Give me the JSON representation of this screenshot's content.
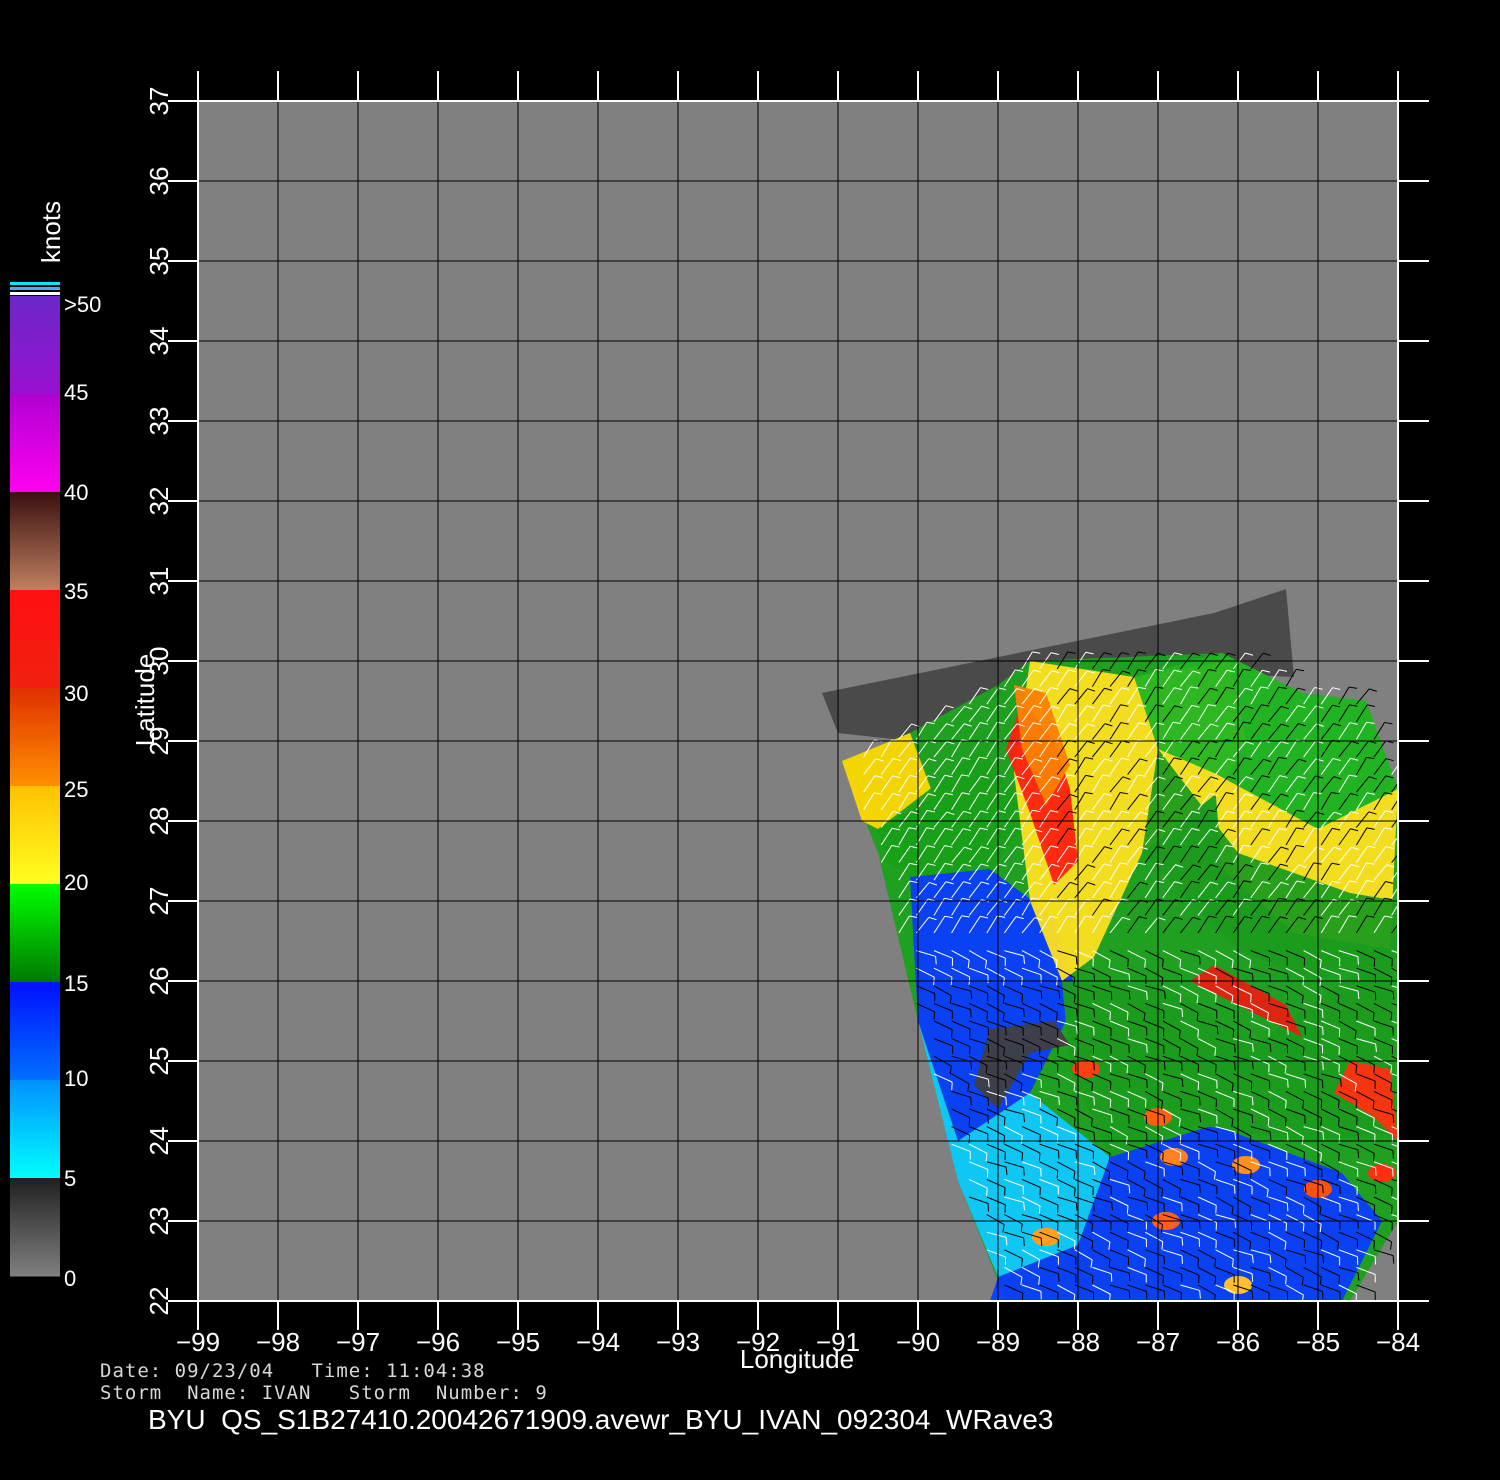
{
  "plot": {
    "xlabel": "Longitude",
    "ylabel": "Latitude",
    "lon_range": [
      -99,
      -84
    ],
    "lat_range": [
      22,
      37
    ],
    "lon_ticks": [
      -99,
      -98,
      -97,
      -96,
      -95,
      -94,
      -93,
      -92,
      -91,
      -90,
      -89,
      -88,
      -87,
      -86,
      -85,
      -84
    ],
    "lat_ticks": [
      22,
      23,
      24,
      25,
      26,
      27,
      28,
      29,
      30,
      31,
      32,
      33,
      34,
      35,
      36,
      37
    ],
    "background_color": "#808080",
    "grid": true
  },
  "colorbar": {
    "unit": "knots",
    "labels": [
      ">50",
      "45",
      "40",
      "35",
      "30",
      "25",
      "20",
      "15",
      "10",
      "5",
      "0"
    ],
    "bands": [
      {
        "from": 45,
        "to": 50,
        "top": "#6a28c8",
        "bottom": "#9a10d0"
      },
      {
        "from": 40,
        "to": 45,
        "top": "#b000d0",
        "bottom": "#ff00f0"
      },
      {
        "from": 35,
        "to": 40,
        "top": "#3a1010",
        "bottom": "#c08060"
      },
      {
        "from": 30,
        "to": 35,
        "top": "#ff1010",
        "bottom": "#f02010"
      },
      {
        "from": 25,
        "to": 30,
        "top": "#e03000",
        "bottom": "#ff9000"
      },
      {
        "from": 20,
        "to": 25,
        "top": "#ffc000",
        "bottom": "#ffff20"
      },
      {
        "from": 15,
        "to": 20,
        "top": "#00ff00",
        "bottom": "#007800"
      },
      {
        "from": 10,
        "to": 15,
        "top": "#0010ff",
        "bottom": "#0070ff"
      },
      {
        "from": 5,
        "to": 10,
        "top": "#0090ff",
        "bottom": "#00ffff"
      },
      {
        "from": 0,
        "to": 5,
        "top": "#202020",
        "bottom": "#808080"
      }
    ]
  },
  "footer": {
    "date_line": "Date: 09/23/04   Time: 11:04:38",
    "storm_line": "Storm  Name: IVAN   Storm  Number: 9",
    "file_line": "BYU  QS_S1B27410.20042671909.avewr_BYU_IVAN_092304_WRave3"
  },
  "swath": {
    "land_polygon_lonlat": [
      [
        -91.2,
        29.6
      ],
      [
        -86.3,
        30.6
      ],
      [
        -85.4,
        30.9
      ],
      [
        -85.3,
        29.8
      ],
      [
        -87.7,
        29.9
      ],
      [
        -88.6,
        29.6
      ],
      [
        -90.1,
        29.0
      ],
      [
        -91.0,
        29.1
      ]
    ],
    "regions": [
      {
        "name": "yellow-west",
        "color": "#ffd800",
        "poly": [
          [
            -90.95,
            28.75
          ],
          [
            -90.1,
            29.1
          ],
          [
            -89.8,
            28.3
          ],
          [
            -90.5,
            27.9
          ],
          [
            -90.7,
            28.0
          ]
        ]
      },
      {
        "name": "green-west",
        "color": "#18a018",
        "poly": [
          [
            -90.5,
            27.9
          ],
          [
            -89.2,
            28.9
          ],
          [
            -88.6,
            28.0
          ],
          [
            -89.1,
            27.4
          ],
          [
            -90.1,
            27.3
          ],
          [
            -90.4,
            27.5
          ]
        ]
      },
      {
        "name": "blue-southwest",
        "color": "#0a3cff",
        "poly": [
          [
            -90.1,
            27.3
          ],
          [
            -89.1,
            27.4
          ],
          [
            -88.3,
            26.8
          ],
          [
            -88.0,
            25.8
          ],
          [
            -88.6,
            24.6
          ],
          [
            -89.5,
            24.0
          ],
          [
            -90.0,
            25.5
          ]
        ]
      },
      {
        "name": "cyan-southwest",
        "color": "#10c8ff",
        "poly": [
          [
            -90.0,
            25.5
          ],
          [
            -89.5,
            24.0
          ],
          [
            -88.6,
            24.6
          ],
          [
            -87.6,
            23.8
          ],
          [
            -88.0,
            22.7
          ],
          [
            -89.0,
            22.3
          ],
          [
            -89.5,
            23.5
          ]
        ]
      },
      {
        "name": "blue-south",
        "color": "#0a3cff",
        "poly": [
          [
            -89.0,
            22.3
          ],
          [
            -88.0,
            22.7
          ],
          [
            -87.6,
            23.8
          ],
          [
            -86.3,
            24.2
          ],
          [
            -84.7,
            23.6
          ],
          [
            -84.2,
            23.0
          ],
          [
            -84.7,
            22.0
          ],
          [
            -88.4,
            22.0
          ],
          [
            -89.1,
            22.0
          ]
        ]
      },
      {
        "name": "yellow-central",
        "color": "#ffe020",
        "poly": [
          [
            -88.6,
            30.0
          ],
          [
            -87.3,
            29.8
          ],
          [
            -86.1,
            30.0
          ],
          [
            -85.9,
            29.0
          ],
          [
            -86.2,
            28.4
          ],
          [
            -87.2,
            27.6
          ],
          [
            -87.8,
            26.3
          ],
          [
            -88.2,
            26.0
          ],
          [
            -88.6,
            27.0
          ],
          [
            -88.8,
            28.6
          ]
        ]
      },
      {
        "name": "green-northeast",
        "color": "#22b422",
        "poly": [
          [
            -87.3,
            29.8
          ],
          [
            -86.2,
            30.1
          ],
          [
            -85.2,
            29.6
          ],
          [
            -84.4,
            29.5
          ],
          [
            -84.0,
            28.4
          ],
          [
            -85.0,
            27.9
          ],
          [
            -86.3,
            28.6
          ],
          [
            -87.0,
            28.9
          ]
        ]
      },
      {
        "name": "yellow-east",
        "color": "#ffe020",
        "poly": [
          [
            -86.3,
            28.6
          ],
          [
            -85.0,
            27.9
          ],
          [
            -84.0,
            28.4
          ],
          [
            -84.1,
            26.4
          ],
          [
            -85.3,
            26.6
          ],
          [
            -86.2,
            27.4
          ]
        ]
      },
      {
        "name": "green-southeast",
        "color": "#1c9c1c",
        "poly": [
          [
            -88.2,
            26.0
          ],
          [
            -86.8,
            25.9
          ],
          [
            -85.8,
            25.2
          ],
          [
            -84.1,
            26.4
          ],
          [
            -84.0,
            24.1
          ],
          [
            -85.2,
            24.0
          ],
          [
            -86.5,
            24.2
          ],
          [
            -87.6,
            23.8
          ],
          [
            -88.1,
            24.9
          ]
        ]
      },
      {
        "name": "green-east",
        "color": "#1c9c1c",
        "poly": [
          [
            -87.0,
            28.9
          ],
          [
            -86.0,
            27.6
          ],
          [
            -84.6,
            27.1
          ],
          [
            -84.0,
            27.0
          ],
          [
            -84.0,
            26.3
          ],
          [
            -85.1,
            26.0
          ],
          [
            -86.0,
            26.4
          ],
          [
            -87.2,
            27.6
          ]
        ]
      },
      {
        "name": "red-band-north",
        "color": "#ff2010",
        "poly": [
          [
            -88.7,
            29.5
          ],
          [
            -88.3,
            29.0
          ],
          [
            -88.1,
            28.4
          ],
          [
            -88.0,
            27.5
          ],
          [
            -88.3,
            27.2
          ],
          [
            -88.6,
            28.1
          ],
          [
            -88.9,
            28.9
          ]
        ]
      },
      {
        "name": "orange-band-north",
        "color": "#ff8000",
        "poly": [
          [
            -88.8,
            29.7
          ],
          [
            -88.4,
            29.6
          ],
          [
            -88.1,
            28.7
          ],
          [
            -88.4,
            28.2
          ],
          [
            -88.7,
            28.9
          ]
        ]
      },
      {
        "name": "red-band-east",
        "color": "#e82010",
        "poly": [
          [
            -86.6,
            26.0
          ],
          [
            -85.6,
            25.5
          ],
          [
            -85.2,
            25.3
          ],
          [
            -85.4,
            25.7
          ],
          [
            -86.3,
            26.2
          ]
        ]
      },
      {
        "name": "red-band-southeast",
        "color": "#ff3010",
        "poly": [
          [
            -84.8,
            24.6
          ],
          [
            -84.3,
            24.3
          ],
          [
            -84.0,
            24.0
          ],
          [
            -84.1,
            24.9
          ],
          [
            -84.6,
            25.0
          ]
        ]
      },
      {
        "name": "dark-patch",
        "color": "#404040",
        "poly": [
          [
            -89.3,
            24.7
          ],
          [
            -89.0,
            24.4
          ],
          [
            -88.6,
            25.1
          ],
          [
            -88.1,
            25.2
          ],
          [
            -88.3,
            25.5
          ],
          [
            -89.1,
            25.4
          ]
        ]
      }
    ],
    "wind_barb_color_light": "#ffffff",
    "wind_barb_color_dark": "#000000"
  }
}
